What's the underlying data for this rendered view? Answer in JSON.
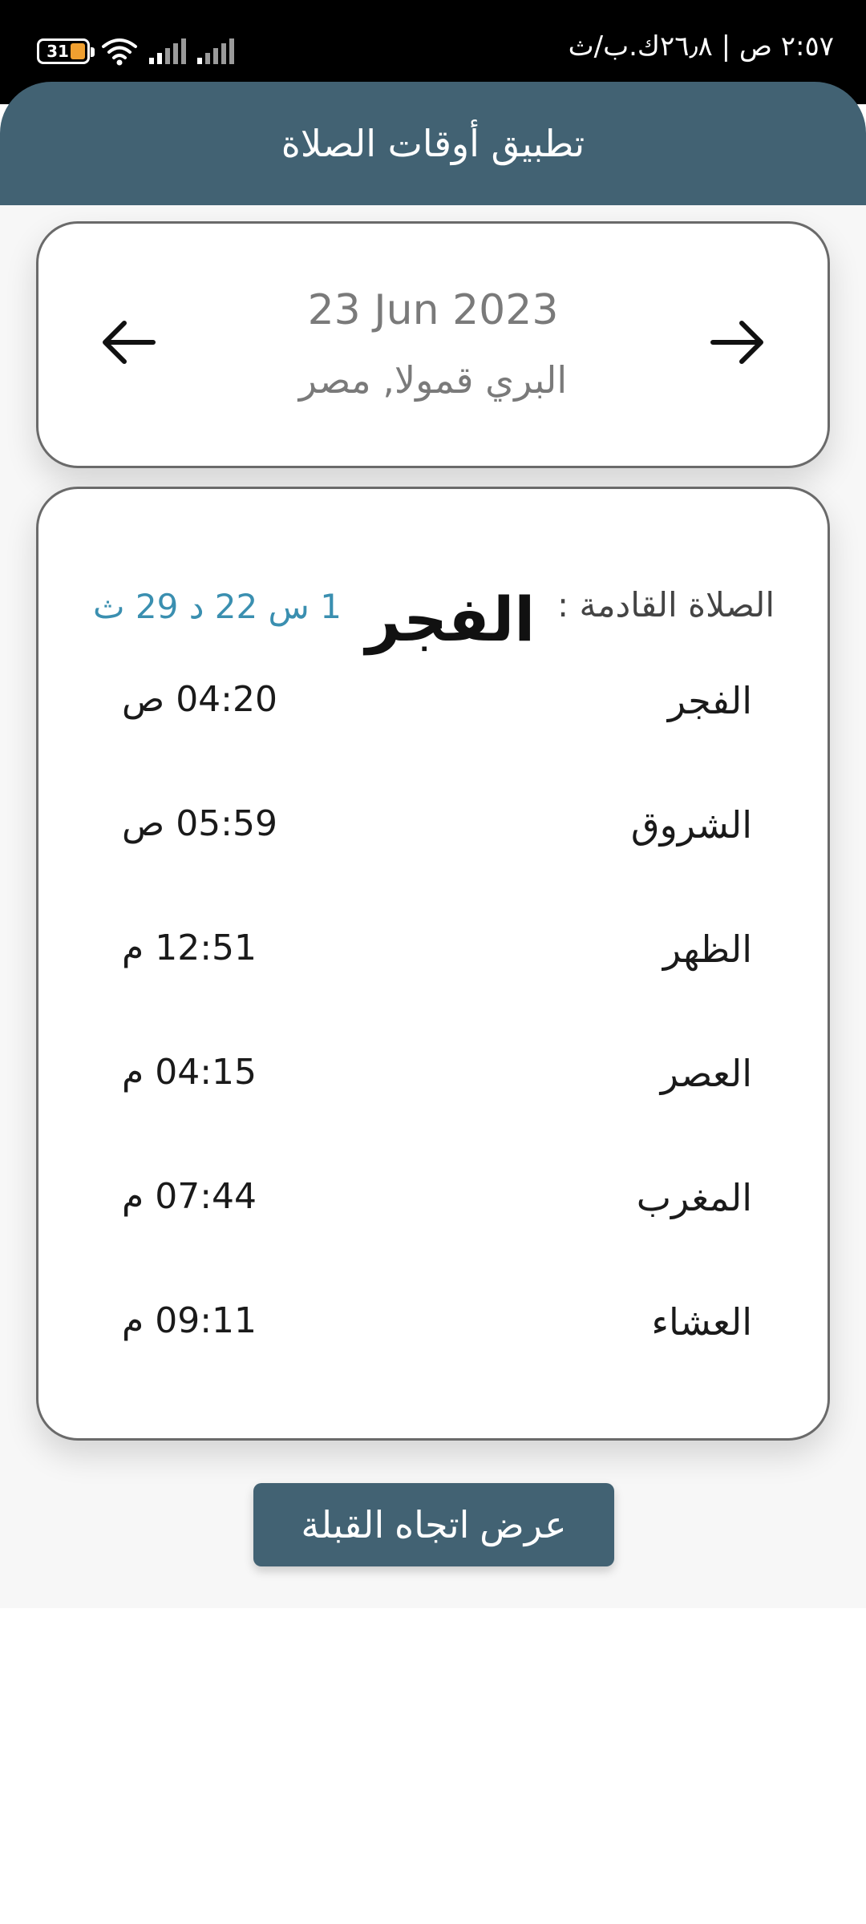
{
  "status_bar": {
    "time_text": "٢:٥٧ ص | ٢٦٫٨ك.ب/ث",
    "battery_level": "31",
    "icons": [
      "battery-icon",
      "wifi-icon",
      "signal-icon",
      "signal-icon"
    ]
  },
  "header": {
    "title": "تطبيق أوقات الصلاة"
  },
  "date_card": {
    "date": "23 Jun 2023",
    "location": "البري قمولا, مصر",
    "prev_icon": "arrow-left-icon",
    "next_icon": "arrow-right-icon"
  },
  "next_prayer": {
    "label": "الصلاة القادمة :",
    "name": "الفجر",
    "countdown": "1 س 22 د 29 ث"
  },
  "prayers": [
    {
      "name": "الفجر",
      "time": "04:20 ص"
    },
    {
      "name": "الشروق",
      "time": "05:59 ص"
    },
    {
      "name": "الظهر",
      "time": "12:51 م"
    },
    {
      "name": "العصر",
      "time": "04:15 م"
    },
    {
      "name": "المغرب",
      "time": "07:44 م"
    },
    {
      "name": "العشاء",
      "time": "09:11 م"
    }
  ],
  "qibla_button": {
    "label": "عرض اتجاه القبلة"
  },
  "colors": {
    "header_bg": "#426273",
    "accent_countdown": "#3a8fb0",
    "button_bg": "#426273"
  }
}
